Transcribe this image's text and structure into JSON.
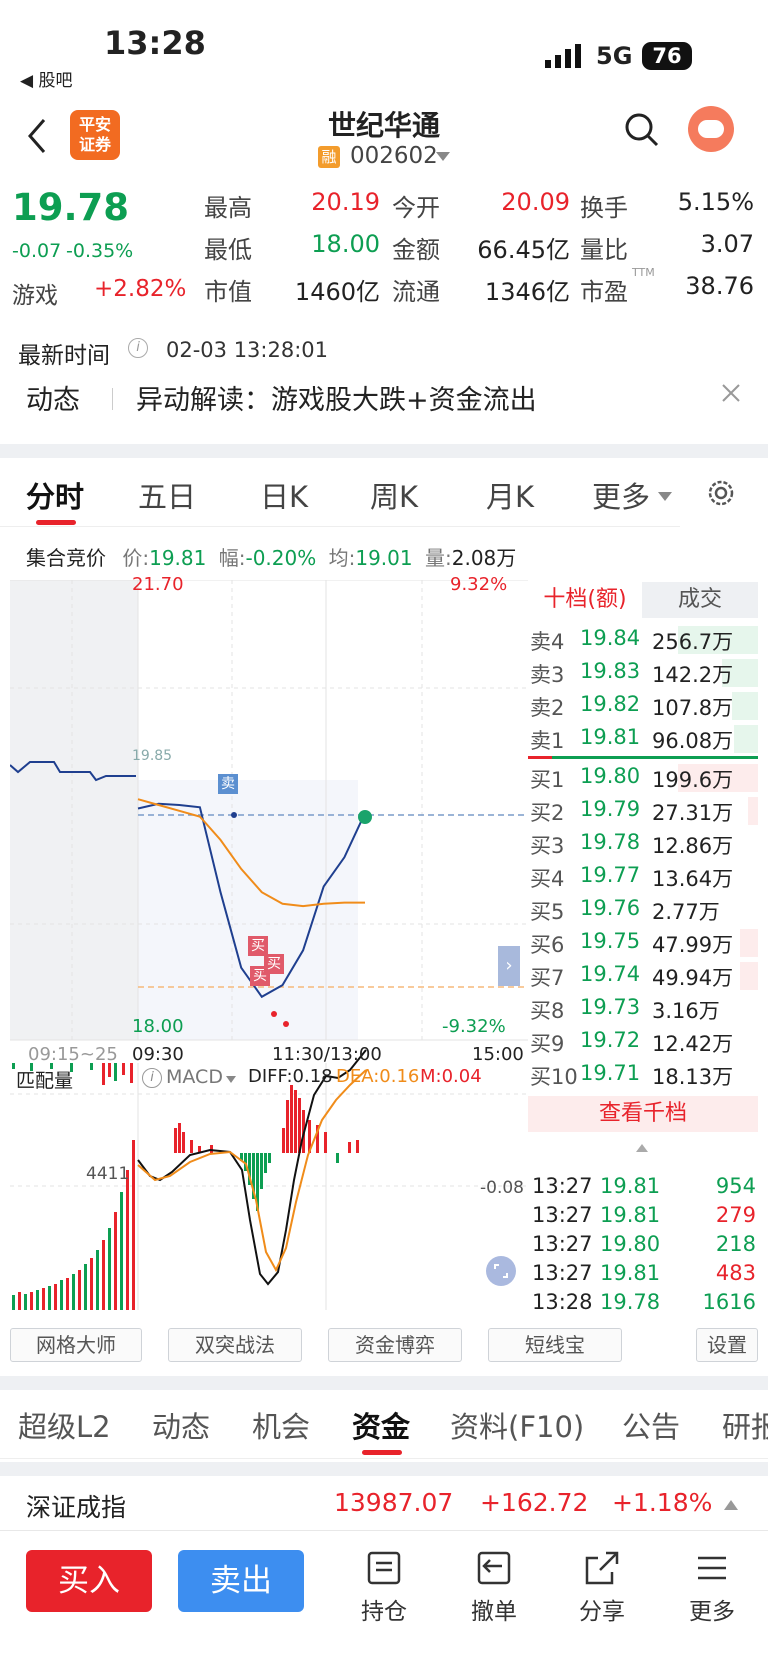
{
  "status": {
    "time": "13:28",
    "back_app": "◀ 股吧",
    "network": "5G",
    "battery": "76"
  },
  "header": {
    "logo_line1": "平安",
    "logo_line2": "证券",
    "title": "世纪华通",
    "badge": "融",
    "code": "002602"
  },
  "quote": {
    "price": "19.78",
    "change": "-0.07",
    "change_pct": "-0.35%",
    "sector_name": "游戏",
    "sector_pct": "+2.82%",
    "fields": [
      {
        "label": "最高",
        "value": "20.19"
      },
      {
        "label": "今开",
        "value": "20.09"
      },
      {
        "label": "换手",
        "value": "5.15%"
      },
      {
        "label": "最低",
        "value": "18.00"
      },
      {
        "label": "金额",
        "value": "66.45亿"
      },
      {
        "label": "量比",
        "value": "3.07"
      },
      {
        "label": "市值",
        "value": "1460亿"
      },
      {
        "label": "流通",
        "value": "1346亿"
      },
      {
        "label": "市盈",
        "value": "38.76"
      }
    ],
    "pe_sup": "TTM",
    "update_label": "最新时间",
    "update_time": "02-03 13:28:01"
  },
  "news": {
    "tag": "动态",
    "text": "异动解读：游戏股大跌+资金流出"
  },
  "chart_tabs": [
    "分时",
    "五日",
    "日K",
    "周K",
    "月K",
    "更多"
  ],
  "auction": {
    "title": "集合竞价",
    "price_label": "价:",
    "price": "19.81",
    "amp_label": "幅:",
    "amp": "-0.20%",
    "avg_label": "均:",
    "avg": "19.01",
    "vol_label": "量:",
    "vol": "2.08万"
  },
  "chart": {
    "high_label": "21.70",
    "low_label": "18.00",
    "high_pct": "9.32%",
    "low_pct": "-9.32%",
    "mid_label": "19.85",
    "time_auction": "09:15~25",
    "time_open": "09:30",
    "time_mid": "11:30/13:00",
    "time_close": "15:00",
    "sell_marker": "卖",
    "buy_marker": "买",
    "sub_left": "匹配量",
    "sub_indicator": "MACD",
    "diff": "DIFF:0.18",
    "dea": "DEA:0.16",
    "m": "M:0.04",
    "vol_label": "4411",
    "macd_label": "-0.08"
  },
  "chart_data": {
    "type": "line",
    "title": "",
    "ylim": [
      18.0,
      21.7
    ],
    "x": [
      "09:30",
      "11:30/13:00",
      "15:00"
    ],
    "series": [
      {
        "name": "",
        "values": [
          19.82,
          19.86,
          19.85,
          19.83,
          19.1,
          18.45,
          18.2,
          18.3,
          18.6,
          19.15,
          19.4,
          19.78
        ]
      },
      {
        "name": "",
        "values": [
          19.9,
          19.85,
          19.8,
          19.75,
          19.55,
          19.3,
          19.1,
          19.0,
          18.98,
          19.0,
          19.01,
          19.01
        ]
      }
    ]
  },
  "orderbook": {
    "tab_active": "十档(额)",
    "tab_other": "成交",
    "sells": [
      {
        "label": "卖4",
        "price": "19.84",
        "amount": "256.7万"
      },
      {
        "label": "卖3",
        "price": "19.83",
        "amount": "142.2万"
      },
      {
        "label": "卖2",
        "price": "19.82",
        "amount": "107.8万"
      },
      {
        "label": "卖1",
        "price": "19.81",
        "amount": "96.08万"
      }
    ],
    "buys": [
      {
        "label": "买1",
        "price": "19.80",
        "amount": "199.6万"
      },
      {
        "label": "买2",
        "price": "19.79",
        "amount": "27.31万"
      },
      {
        "label": "买3",
        "price": "19.78",
        "amount": "12.86万"
      },
      {
        "label": "买4",
        "price": "19.77",
        "amount": "13.64万"
      },
      {
        "label": "买5",
        "price": "19.76",
        "amount": "2.77万"
      },
      {
        "label": "买6",
        "price": "19.75",
        "amount": "47.99万"
      },
      {
        "label": "买7",
        "price": "19.74",
        "amount": "49.94万"
      },
      {
        "label": "买8",
        "price": "19.73",
        "amount": "3.16万"
      },
      {
        "label": "买9",
        "price": "19.72",
        "amount": "12.42万"
      },
      {
        "label": "买10",
        "price": "19.71",
        "amount": "18.13万"
      }
    ],
    "more_button": "查看千档",
    "trades": [
      {
        "time": "13:27",
        "price": "19.81",
        "vol": "954",
        "color": "#0d9e52"
      },
      {
        "time": "13:27",
        "price": "19.81",
        "vol": "279",
        "color": "#e8232b"
      },
      {
        "time": "13:27",
        "price": "19.80",
        "vol": "218",
        "color": "#0d9e52"
      },
      {
        "time": "13:27",
        "price": "19.81",
        "vol": "483",
        "color": "#e8232b"
      },
      {
        "time": "13:28",
        "price": "19.78",
        "vol": "1616",
        "color": "#0d9e52"
      }
    ]
  },
  "tools": [
    "网格大师",
    "双突战法",
    "资金博弈",
    "短线宝",
    "设置"
  ],
  "bottom_tabs": [
    "超级L2",
    "动态",
    "机会",
    "资金",
    "资料(F10)",
    "公告",
    "研报"
  ],
  "index": {
    "name": "深证成指",
    "value": "13987.07",
    "change": "+162.72",
    "pct": "+1.18%"
  },
  "actions": {
    "buy": "买入",
    "sell": "卖出",
    "position": "持仓",
    "cancel": "撤单",
    "share": "分享",
    "more": "更多"
  },
  "colors": {
    "up": "#e8232b",
    "down": "#0d9e52",
    "price_line": "#1f3f8f",
    "avg_line": "#f08c1a",
    "sell_btn": "#3d8ef0"
  }
}
